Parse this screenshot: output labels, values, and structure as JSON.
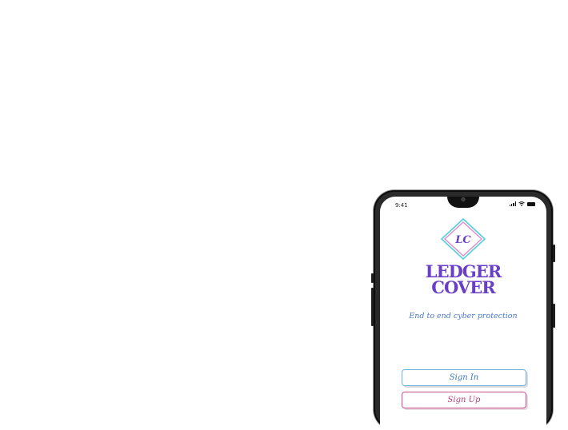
{
  "status_bar": {
    "time": "9:41",
    "signal_icon": "signal-icon",
    "wifi_icon": "wifi-icon",
    "battery_icon": "battery-icon"
  },
  "app": {
    "logo_monogram": "LC",
    "brand_line1": "LEDGER",
    "brand_line2": "COVER",
    "tagline": "End to end cyber protection",
    "sign_in_label": "Sign In",
    "sign_up_label": "Sign Up"
  },
  "colors": {
    "brand_purple": "#6a3fc8",
    "tagline_blue": "#4a78c8",
    "logo_cyan": "#4fd0e0",
    "logo_pink": "#e08ad0",
    "signin_border": "#6fb4d8",
    "signup_border": "#d0508e"
  }
}
